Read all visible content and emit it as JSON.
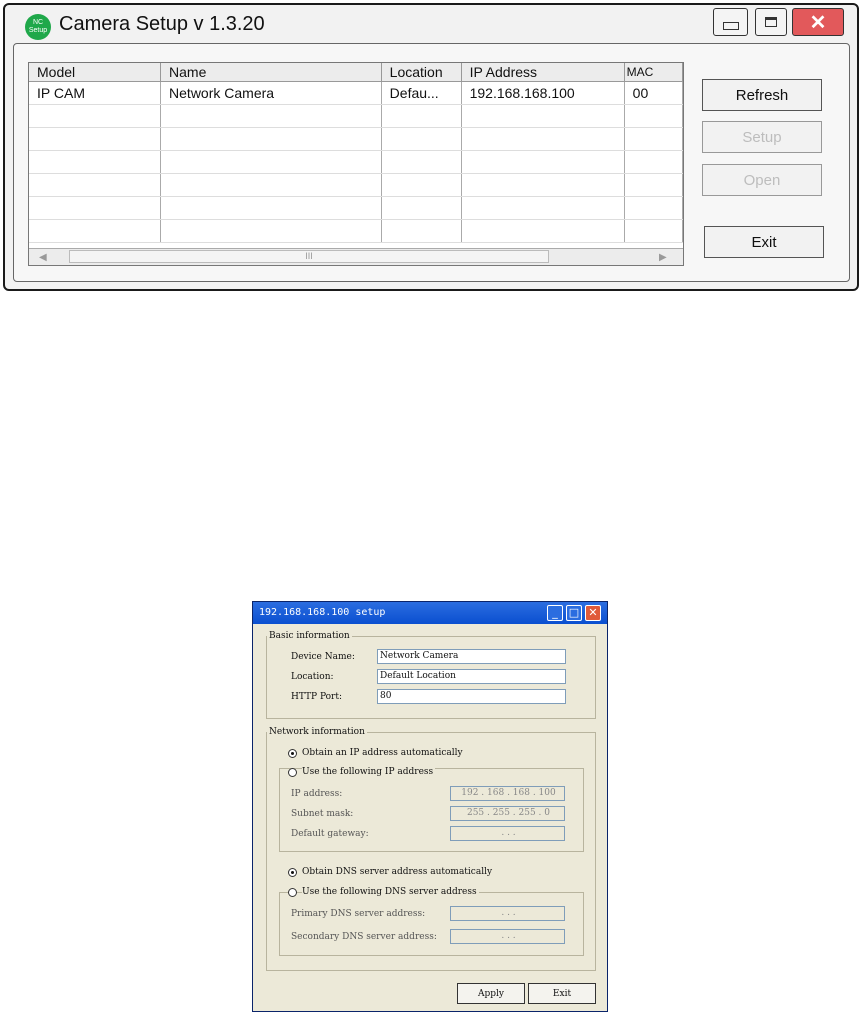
{
  "main_window": {
    "logo_text": [
      "NC",
      "Setup"
    ],
    "title": "Camera Setup v 1.3.20",
    "close_glyph": "✕",
    "table": {
      "columns": [
        "Model",
        "Name",
        "Location",
        "IP Address",
        "MAC"
      ],
      "rows": [
        [
          "IP CAM",
          "Network Camera",
          "Defau...",
          "192.168.168.100",
          "00"
        ]
      ]
    },
    "scroll_left": "◀",
    "scroll_right": "▶",
    "scroll_grip": "III",
    "buttons": {
      "refresh": "Refresh",
      "setup": "Setup",
      "open": "Open",
      "exit": "Exit"
    },
    "colors": {
      "close_button": "#e2595b",
      "logo": "#1fa84a"
    }
  },
  "setup_dialog": {
    "title": "192.168.168.100 setup",
    "basic": {
      "legend": "Basic information",
      "device_name_label": "Device Name:",
      "device_name_value": "Network Camera",
      "location_label": "Location:",
      "location_value": "Default Location",
      "http_port_label": "HTTP Port:",
      "http_port_value": "80"
    },
    "network": {
      "legend": "Network information",
      "obtain_ip_auto": "Obtain an IP address automatically",
      "use_following_ip": "Use the following IP address",
      "ip_label": "IP address:",
      "ip_value": "192 . 168 . 168 . 100",
      "subnet_label": "Subnet mask:",
      "subnet_value": "255 . 255 . 255 . 0",
      "gateway_label": "Default gateway:",
      "gateway_value": ". . .",
      "obtain_dns_auto": "Obtain DNS server address automatically",
      "use_following_dns": "Use the following DNS server address",
      "primary_dns_label": "Primary DNS server address:",
      "primary_dns_value": ". . .",
      "secondary_dns_label": "Secondary DNS server address:",
      "secondary_dns_value": ". . ."
    },
    "buttons": {
      "apply": "Apply",
      "exit": "Exit"
    },
    "title_buttons": {
      "minimize": "_",
      "maximize": "□",
      "close": "✕"
    }
  }
}
